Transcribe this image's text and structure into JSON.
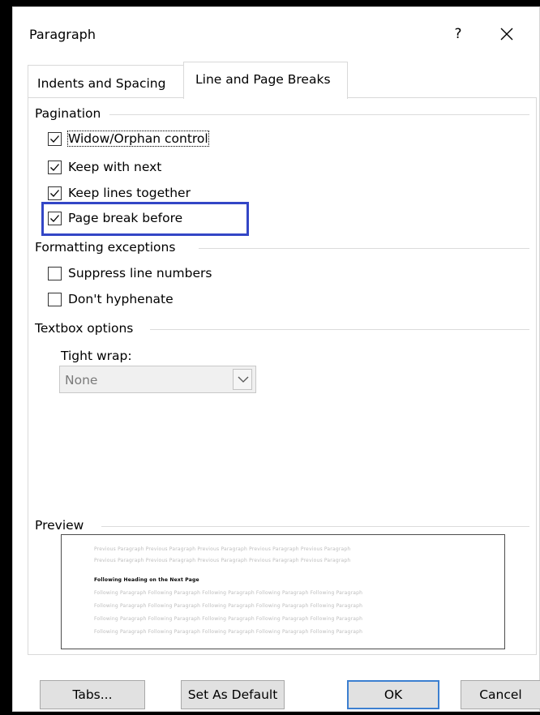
{
  "window": {
    "title": "Paragraph",
    "help_label": "?"
  },
  "tabs": [
    {
      "label": "Indents and Spacing",
      "selected": false
    },
    {
      "label": "Line and Page Breaks",
      "selected": true
    }
  ],
  "pagination": {
    "heading": "Pagination",
    "options": [
      {
        "label": "Widow/Orphan control",
        "checked": true
      },
      {
        "label": "Keep with next",
        "checked": true
      },
      {
        "label": "Keep lines together",
        "checked": true
      },
      {
        "label": "Page break before",
        "checked": true
      }
    ]
  },
  "formatting_exceptions": {
    "heading": "Formatting exceptions",
    "options": [
      {
        "label": "Suppress line numbers",
        "checked": false
      },
      {
        "label": "Don't hyphenate",
        "checked": false
      }
    ]
  },
  "textbox_options": {
    "heading": "Textbox options",
    "tight_wrap_label": "Tight wrap:",
    "tight_wrap_value": "None"
  },
  "preview": {
    "heading": "Preview",
    "previous_line": "Previous Paragraph Previous Paragraph Previous Paragraph Previous Paragraph Previous Paragraph",
    "current_line": "Following Heading on the Next Page",
    "following_line": "Following Paragraph Following Paragraph Following Paragraph Following Paragraph Following Paragraph"
  },
  "buttons": {
    "tabs": "Tabs...",
    "set_as_default": "Set As Default",
    "ok": "OK",
    "cancel": "Cancel"
  },
  "colors": {
    "highlight": "#3346c6",
    "ok_focus": "#3c7fd0"
  }
}
